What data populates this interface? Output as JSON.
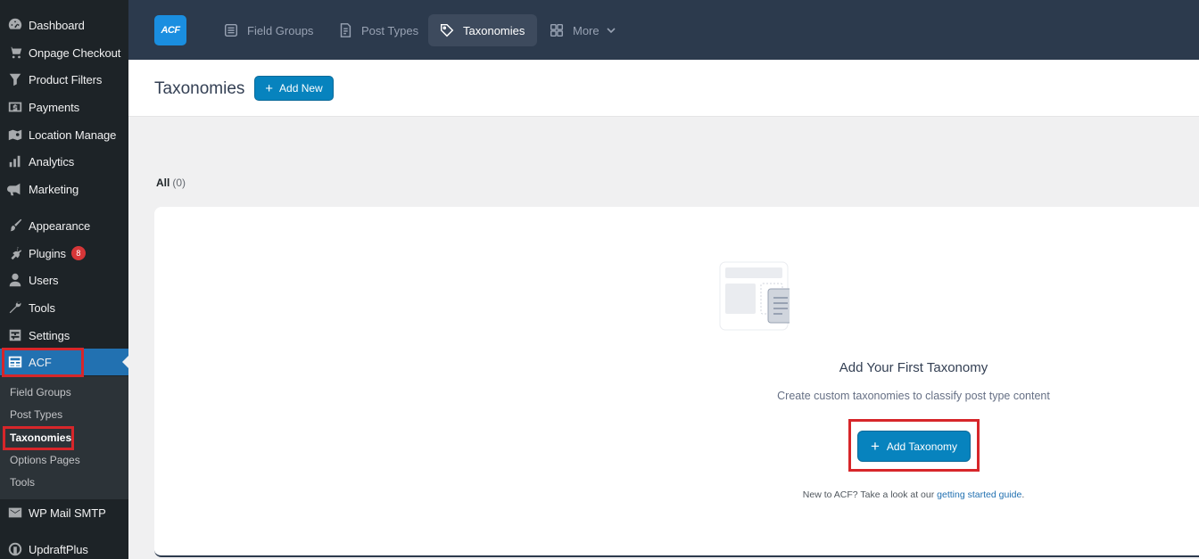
{
  "sidebar": {
    "items": [
      {
        "label": "Dashboard",
        "icon": "dashboard-icon"
      },
      {
        "label": "Onpage Checkout",
        "icon": "cart-icon"
      },
      {
        "label": "Product Filters",
        "icon": "filter-icon"
      },
      {
        "label": "Payments",
        "icon": "dollar-icon"
      },
      {
        "label": "Location Manage",
        "icon": "location-icon"
      },
      {
        "label": "Analytics",
        "icon": "analytics-icon"
      },
      {
        "label": "Marketing",
        "icon": "megaphone-icon"
      },
      {
        "label": "Appearance",
        "icon": "paintbrush-icon"
      },
      {
        "label": "Plugins",
        "icon": "plugin-icon",
        "badge": "8"
      },
      {
        "label": "Users",
        "icon": "users-icon"
      },
      {
        "label": "Tools",
        "icon": "wrench-icon"
      },
      {
        "label": "Settings",
        "icon": "settings-icon"
      },
      {
        "label": "ACF",
        "icon": "acf-table-icon",
        "active": true
      },
      {
        "label": "WP Mail SMTP",
        "icon": "mail-icon"
      },
      {
        "label": "UpdraftPlus",
        "icon": "updraft-icon"
      }
    ],
    "acf_submenu": [
      "Field Groups",
      "Post Types",
      "Taxonomies",
      "Options Pages",
      "Tools"
    ],
    "acf_submenu_current": "Taxonomies"
  },
  "topbar": {
    "logo_text": "ACF",
    "tabs": [
      {
        "label": "Field Groups",
        "icon": "field-groups-icon"
      },
      {
        "label": "Post Types",
        "icon": "post-types-icon"
      },
      {
        "label": "Taxonomies",
        "icon": "tag-icon",
        "active": true
      },
      {
        "label": "More",
        "icon": "grid-icon"
      }
    ]
  },
  "header": {
    "title": "Taxonomies",
    "add_new_label": "Add New"
  },
  "filters": {
    "all_label": "All",
    "all_count": "(0)"
  },
  "empty_state": {
    "title": "Add Your First Taxonomy",
    "description": "Create custom taxonomies to classify post type content",
    "button_label": "Add Taxonomy",
    "help_prefix": "New to ACF? Take a look at our",
    "help_link": "getting started guide",
    "help_suffix": "."
  },
  "colors": {
    "sidebar_bg": "#1d2327",
    "topbar_bg": "#2c3a4d",
    "accent": "#0783be",
    "active_menu": "#2271b1",
    "highlight_border": "#d7262a"
  }
}
